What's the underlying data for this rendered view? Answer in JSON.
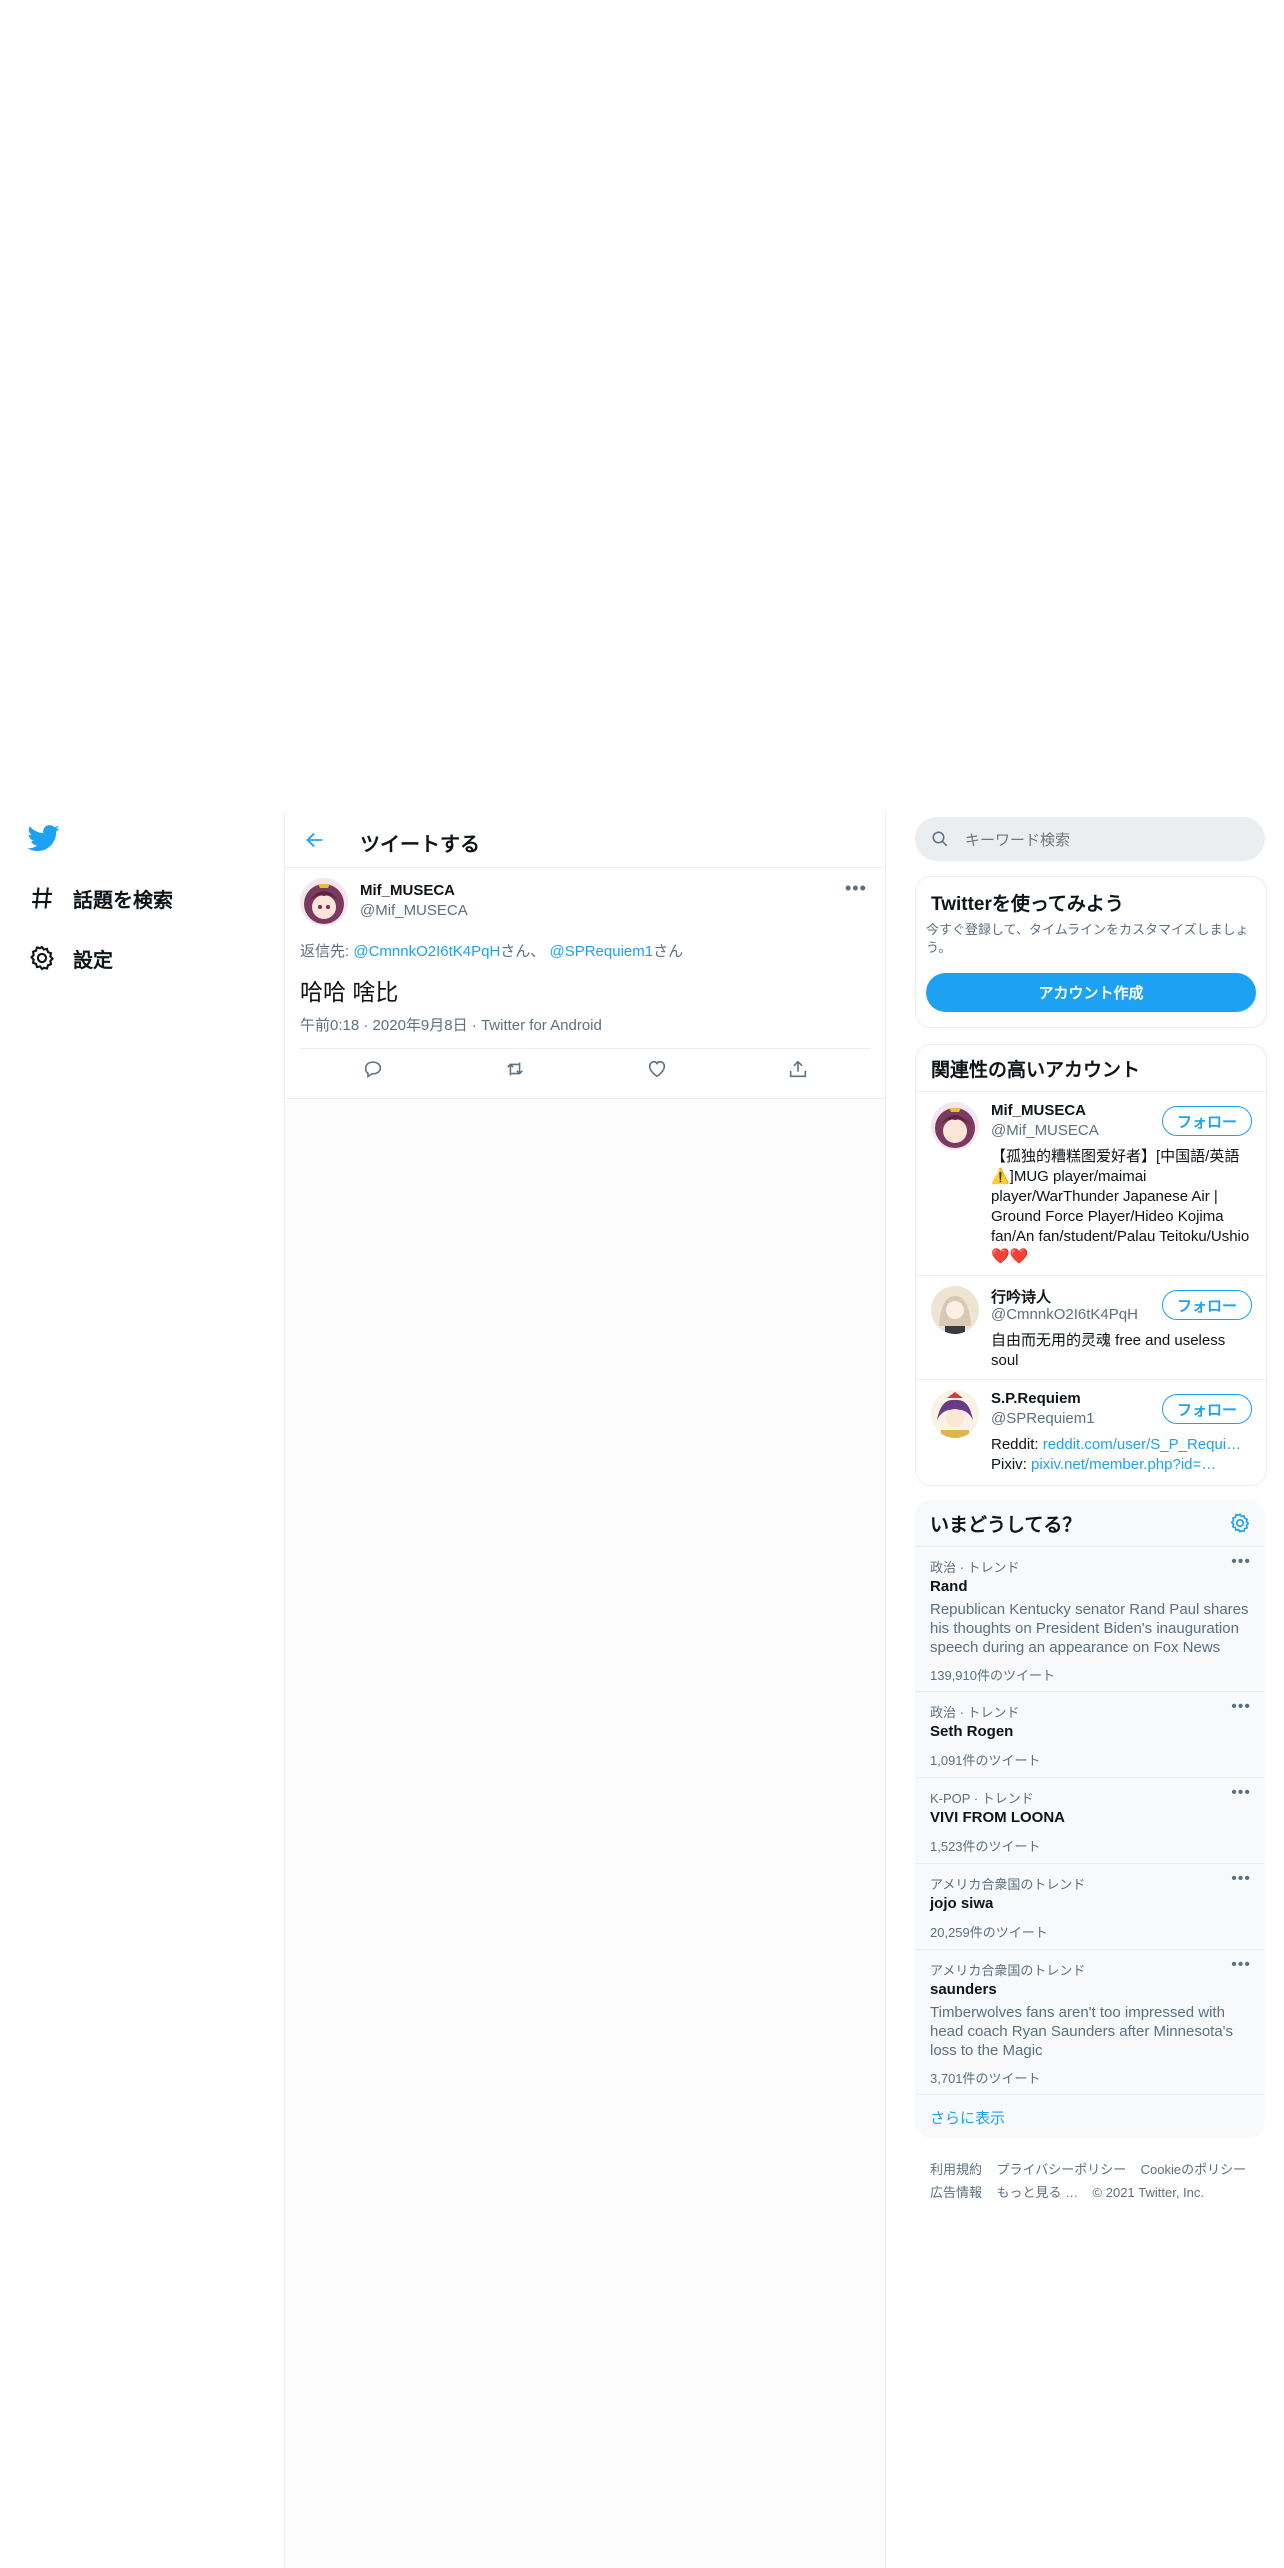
{
  "colors": {
    "accent": "#1da1f2",
    "text": "#0f1419",
    "muted": "#5b7083",
    "divider": "#ebeef0"
  },
  "nav": {
    "logo": "twitter-bird-icon",
    "items": [
      {
        "label": "話題を検索",
        "icon": "hashtag-icon"
      },
      {
        "label": "設定",
        "icon": "gear-icon"
      }
    ]
  },
  "header": {
    "title": "ツイートする",
    "back_icon": "arrow-left-icon"
  },
  "tweet": {
    "author_name": "Mif_MUSECA",
    "author_handle": "@Mif_MUSECA",
    "reply_prefix": "返信先: ",
    "reply_to_1": "@CmnnkO2I6tK4PqH",
    "reply_suffix_1": "さん、",
    "reply_to_2": "@SPRequiem1",
    "reply_suffix_2": "さん",
    "text": "哈哈 啥比",
    "time": "午前0:18",
    "date": "2020年9月8日",
    "source": "Twitter for Android",
    "sep": "·"
  },
  "search": {
    "placeholder": "キーワード検索"
  },
  "signup": {
    "title": "Twitterを使ってみよう",
    "desc": "今すぐ登録して、タイムラインをカスタマイズしましょう。",
    "button": "アカウント作成"
  },
  "related": {
    "title": "関連性の高いアカウント",
    "follow_label": "フォロー",
    "accounts": [
      {
        "name": "Mif_MUSECA",
        "handle": "@Mif_MUSECA",
        "bio": "【孤独的糟糕图爱好者】[中国語/英語⚠️]MUG player/maimai player/WarThunder Japanese Air | Ground Force Player/Hideo Kojima fan/An fan/student/Palau Teitoku/Ushio❤️❤️"
      },
      {
        "name": "行吟诗人",
        "handle": "@CmnnkO2I6tK4PqH",
        "bio": "自由而无用的灵魂 free and useless soul"
      },
      {
        "name": "S.P.Requiem",
        "handle": "@SPRequiem1",
        "bio_line1_prefix": "Reddit: ",
        "bio_line1_link": "reddit.com/user/S_P_Requi…",
        "bio_line2_prefix": "Pixiv: ",
        "bio_line2_link": "pixiv.net/member.php?id=…"
      }
    ]
  },
  "trends": {
    "title": "いまどうしてる？",
    "more_label": "さらに表示",
    "items": [
      {
        "context": "政治 · トレンド",
        "name": "Rand",
        "desc": "Republican Kentucky senator Rand Paul shares his thoughts on President Biden's inauguration speech during an appearance on Fox News",
        "count": "139,910件のツイート"
      },
      {
        "context": "政治 · トレンド",
        "name": "Seth Rogen",
        "count": "1,091件のツイート"
      },
      {
        "context": "K-POP · トレンド",
        "name": "VIVI FROM LOONA",
        "count": "1,523件のツイート"
      },
      {
        "context": "アメリカ合衆国のトレンド",
        "name": "jojo siwa",
        "count": "20,259件のツイート"
      },
      {
        "context": "アメリカ合衆国のトレンド",
        "name": "saunders",
        "desc": "Timberwolves fans aren't too impressed with head coach Ryan Saunders after Minnesota's loss to the Magic",
        "count": "3,701件のツイート"
      }
    ]
  },
  "footer": {
    "links": [
      "利用規約",
      "プライバシーポリシー",
      "Cookieのポリシー",
      "広告情報",
      "もっと見る …"
    ],
    "copyright": "© 2021 Twitter, Inc."
  }
}
